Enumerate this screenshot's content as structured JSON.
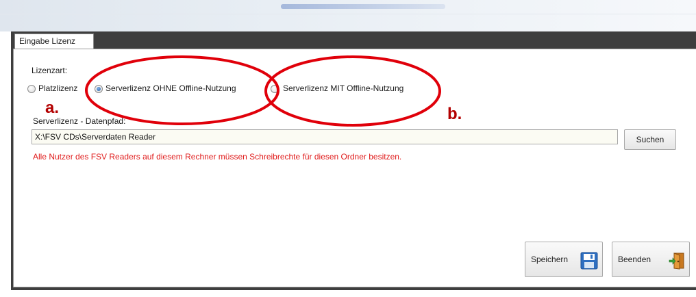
{
  "tab": {
    "label": "Eingabe Lizenz"
  },
  "license": {
    "type_label": "Lizenzart:",
    "options": [
      {
        "label": "Platzlizenz",
        "checked": false
      },
      {
        "label": "Serverlizenz OHNE Offline-Nutzung",
        "checked": true
      },
      {
        "label": "Serverlizenz MIT Offline-Nutzung",
        "checked": false
      }
    ]
  },
  "server": {
    "path_label": "Serverlizenz - Datenpfad:",
    "path_value": "X:\\FSV CDs\\Serverdaten Reader",
    "search_button": "Suchen",
    "warning": "Alle Nutzer des FSV Readers auf diesem Rechner müssen Schreibrechte für diesen Ordner besitzen."
  },
  "actions": {
    "save_label": "Speichern",
    "close_label": "Beenden"
  },
  "annotations": {
    "a": "a.",
    "b": "b.",
    "color": "#e0000a"
  },
  "icons": {
    "save": "floppy-disk-icon",
    "close": "exit-door-icon"
  }
}
